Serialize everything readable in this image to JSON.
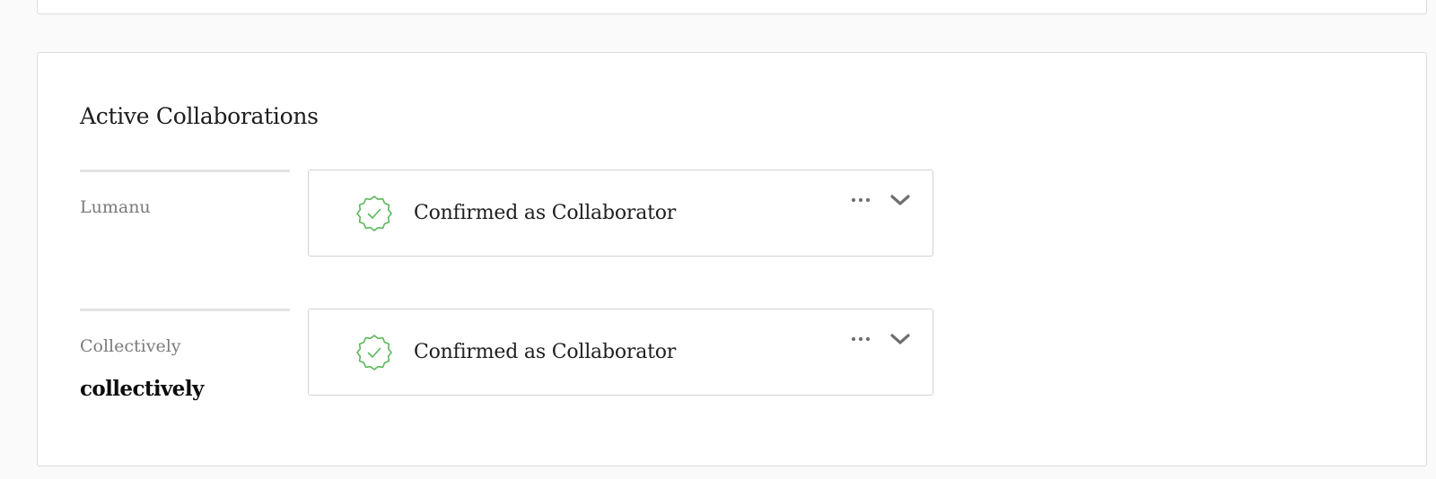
{
  "section": {
    "title": "Active Collaborations"
  },
  "collaborations": [
    {
      "organization": "Lumanu",
      "logo_text": "",
      "status": "Confirmed as Collaborator"
    },
    {
      "organization": "Collectively",
      "logo_text": "collectively",
      "status": "Confirmed as Collaborator"
    }
  ],
  "icons": {
    "status_badge": "verified-badge-icon",
    "more": "more-horizontal-icon",
    "expand": "chevron-down-icon"
  },
  "colors": {
    "badge_green": "#5cb85c",
    "icon_gray": "#6f6f6f",
    "muted_text": "#7b7b7b"
  }
}
